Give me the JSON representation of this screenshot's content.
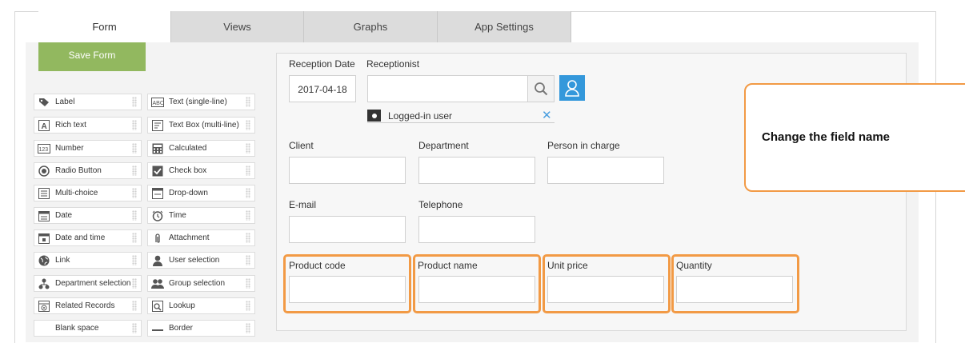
{
  "tabs": [
    {
      "label": "Form"
    },
    {
      "label": "Views"
    },
    {
      "label": "Graphs"
    },
    {
      "label": "App Settings"
    }
  ],
  "save_button": "Save Form",
  "palette": {
    "left": [
      {
        "label": "Label",
        "icon": "tag-icon"
      },
      {
        "label": "Rich text",
        "icon": "rich-text-icon"
      },
      {
        "label": "Number",
        "icon": "number-icon"
      },
      {
        "label": "Radio Button",
        "icon": "radio-icon"
      },
      {
        "label": "Multi-choice",
        "icon": "multi-choice-icon"
      },
      {
        "label": "Date",
        "icon": "date-icon"
      },
      {
        "label": "Date and time",
        "icon": "date-time-icon"
      },
      {
        "label": "Link",
        "icon": "globe-icon"
      },
      {
        "label": "Department selection",
        "icon": "org-chart-icon"
      },
      {
        "label": "Related Records",
        "icon": "related-records-icon"
      },
      {
        "label": "Blank space",
        "icon": ""
      }
    ],
    "right": [
      {
        "label": "Text (single-line)",
        "icon": "abc-icon"
      },
      {
        "label": "Text Box (multi-line)",
        "icon": "text-box-icon"
      },
      {
        "label": "Calculated",
        "icon": "calculator-icon"
      },
      {
        "label": "Check box",
        "icon": "checkbox-icon"
      },
      {
        "label": "Drop-down",
        "icon": "dropdown-icon"
      },
      {
        "label": "Time",
        "icon": "clock-icon"
      },
      {
        "label": "Attachment",
        "icon": "paperclip-icon"
      },
      {
        "label": "User selection",
        "icon": "user-icon"
      },
      {
        "label": "Group selection",
        "icon": "group-icon"
      },
      {
        "label": "Lookup",
        "icon": "lookup-icon"
      },
      {
        "label": "Border",
        "icon": "border-icon"
      }
    ]
  },
  "form": {
    "reception_date_label": "Reception Date",
    "reception_date_value": "2017-04-18",
    "receptionist_label": "Receptionist",
    "logged_in_chip": "Logged-in user",
    "client_label": "Client",
    "department_label": "Department",
    "person_label": "Person in charge",
    "email_label": "E-mail",
    "telephone_label": "Telephone",
    "product_code_label": "Product code",
    "product_name_label": "Product name",
    "unit_price_label": "Unit price",
    "quantity_label": "Quantity"
  },
  "callout": "Change the field name",
  "colors": {
    "accent_green": "#92b85f",
    "highlight_orange": "#f29a45",
    "user_button_blue": "#3498db"
  }
}
